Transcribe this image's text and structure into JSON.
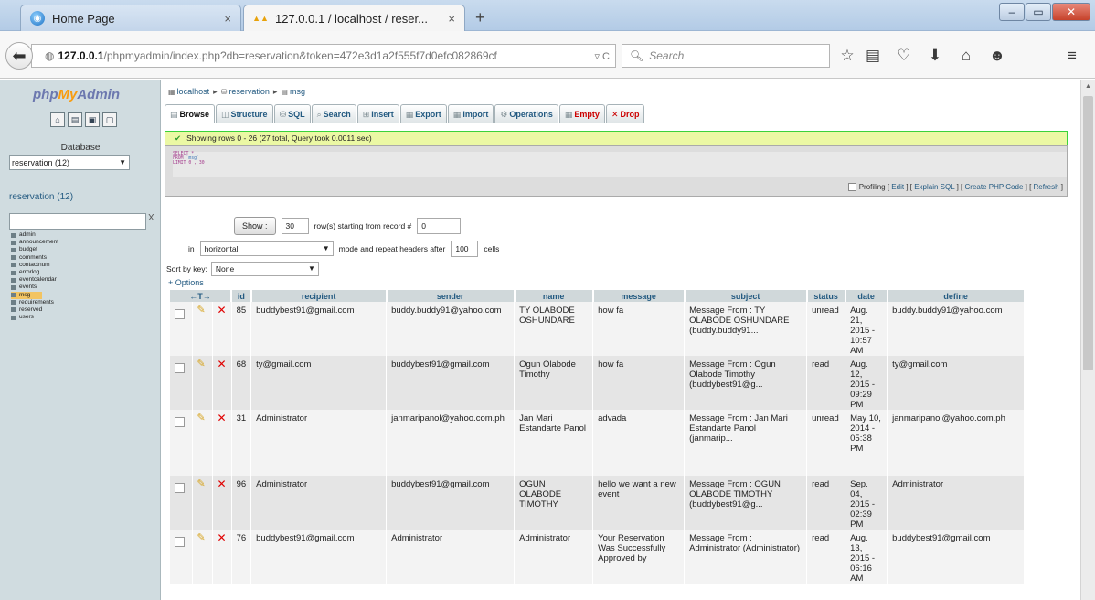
{
  "browser": {
    "tabs": [
      {
        "title": "Home Page",
        "close": "×"
      },
      {
        "title": "127.0.0.1 / localhost / reser...",
        "close": "×"
      }
    ],
    "new_tab": "+",
    "window_controls": {
      "min": "–",
      "max": "▭",
      "close": "✕"
    },
    "url_host": "127.0.0.1",
    "url_path": "/phpmyadmin/index.php?db=reservation&token=472e3d1a2f555f7d0efc082869cf",
    "url_right": "▿ C",
    "search_placeholder": "Search",
    "toolbar_icons": [
      "star-icon",
      "reading-list-icon",
      "pocket-icon",
      "download-icon",
      "home-icon",
      "chat-icon",
      "menu-icon"
    ]
  },
  "pma_nav": {
    "logo": {
      "php": "php",
      "my": "My",
      "admin": "Admin"
    },
    "database_label": "Database",
    "database_select": "reservation (12)",
    "db_link": "reservation (12)",
    "filter_clear": "X",
    "tables": [
      "admin",
      "announcement",
      "budget",
      "comments",
      "contactnum",
      "errorlog",
      "eventcalendar",
      "events",
      "msg",
      "requirements",
      "reserved",
      "users"
    ],
    "selected_table": "msg"
  },
  "breadcrumb": {
    "server": "localhost",
    "database": "reservation",
    "table": "msg"
  },
  "tabs": [
    {
      "label": "Browse",
      "active": true
    },
    {
      "label": "Structure"
    },
    {
      "label": "SQL"
    },
    {
      "label": "Search"
    },
    {
      "label": "Insert"
    },
    {
      "label": "Export"
    },
    {
      "label": "Import"
    },
    {
      "label": "Operations"
    },
    {
      "label": "Empty",
      "danger": true
    },
    {
      "label": "Drop",
      "danger": true
    }
  ],
  "status_message": "Showing rows 0 - 26 (27 total, Query took 0.0011 sec)",
  "sql_query": {
    "line1": "SELECT *",
    "line2_kw": "FROM",
    "line2_tbl": "`msg`",
    "line3": "LIMIT 0 , 30"
  },
  "sql_links": {
    "profiling": "Profiling",
    "edit": "Edit",
    "explain": "Explain SQL",
    "php_code": "Create PHP Code",
    "refresh": "Refresh"
  },
  "controls": {
    "show_button": "Show :",
    "rows_value": "30",
    "rows_text": "row(s) starting from record #",
    "start_value": "0",
    "in_text": "in",
    "mode_value": "horizontal",
    "mode_text": "mode and repeat headers after",
    "repeat_value": "100",
    "cells_text": "cells",
    "sort_label": "Sort by key:",
    "sort_value": "None",
    "options_link": "+ Options"
  },
  "table": {
    "nav_arrows": "←T→",
    "columns": [
      "id",
      "recipient",
      "sender",
      "name",
      "message",
      "subject",
      "status",
      "date",
      "define"
    ],
    "rows": [
      {
        "id": "85",
        "recipient": "buddybest91@gmail.com",
        "sender": "buddy.buddy91@yahoo.com",
        "name": "TY OLABODE OSHUNDARE",
        "message": "how fa",
        "subject": "Message From : TY OLABODE OSHUNDARE (buddy.buddy91...",
        "status": "unread",
        "date": "Aug. 21, 2015 - 10:57 AM",
        "define": "buddy.buddy91@yahoo.com"
      },
      {
        "id": "68",
        "recipient": "ty@gmail.com",
        "sender": "buddybest91@gmail.com",
        "name": "Ogun Olabode Timothy",
        "message": "how fa",
        "subject": "Message From : Ogun Olabode Timothy (buddybest91@g...",
        "status": "read",
        "date": "Aug. 12, 2015 - 09:29 PM",
        "define": "ty@gmail.com"
      },
      {
        "id": "31",
        "recipient": "Administrator",
        "sender": "janmaripanol@yahoo.com.ph",
        "name": "Jan Mari Estandarte Panol",
        "message": "advada",
        "subject": "Message From : Jan Mari Estandarte Panol (janmarip...",
        "status": "unread",
        "date": "May 10, 2014 - 05:38 PM",
        "define": "janmaripanol@yahoo.com.ph"
      },
      {
        "id": "96",
        "recipient": "Administrator",
        "sender": "buddybest91@gmail.com",
        "name": "OGUN OLABODE TIMOTHY",
        "message": "hello we want a new event",
        "subject": "Message From : OGUN OLABODE TIMOTHY (buddybest91@g...",
        "status": "read",
        "date": "Sep. 04, 2015 - 02:39 PM",
        "define": "Administrator"
      },
      {
        "id": "76",
        "recipient": "buddybest91@gmail.com",
        "sender": "Administrator",
        "name": "Administrator",
        "message": "Your Reservation Was Successfully Approved by",
        "subject": "Message From : Administrator (Administrator)",
        "status": "read",
        "date": "Aug. 13, 2015 - 06:16 AM",
        "define": "buddybest91@gmail.com"
      }
    ]
  },
  "colors": {
    "accent_link": "#235a81",
    "nav_bg": "#d0dce0",
    "success_border": "#3ad23a",
    "success_bg": "#ebf8a4",
    "delete": "#e00000"
  }
}
